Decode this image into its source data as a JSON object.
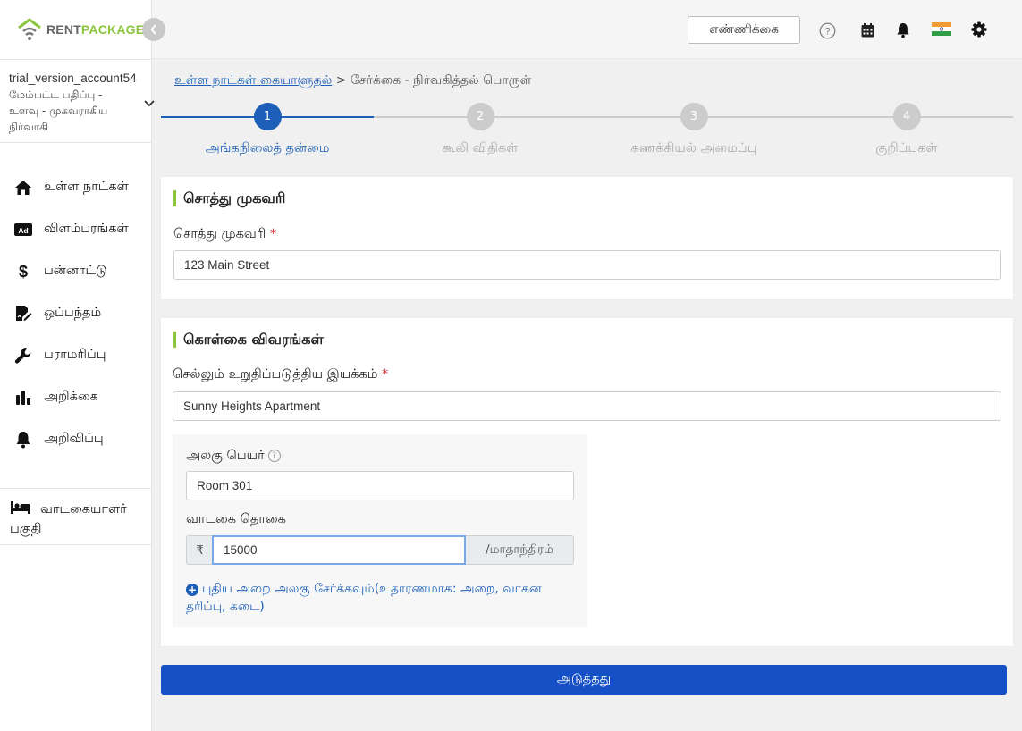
{
  "brand": {
    "rent": "RENT",
    "package": "PACKAGE"
  },
  "account": {
    "name": "trial_version_account54",
    "role": "மேம்பட்ட பதிப்பு - உளவு - முகவராகிய நிர்வாகி"
  },
  "sidebar": {
    "items": [
      {
        "label": "உள்ள நாட்கள்",
        "icon": "home-icon"
      },
      {
        "label": "விளம்பரங்கள்",
        "icon": "ad-icon"
      },
      {
        "label": "பன்னாட்டு",
        "icon": "dollar-icon"
      },
      {
        "label": "ஒப்பந்தம்",
        "icon": "contract-icon"
      },
      {
        "label": "பராமரிப்பு",
        "icon": "wrench-icon"
      },
      {
        "label": "அறிக்கை",
        "icon": "chart-icon"
      },
      {
        "label": "அறிவிப்பு",
        "icon": "bell-icon"
      }
    ],
    "tenant": {
      "label": "வாடகையாளர் பகுதி",
      "icon": "bed-icon"
    }
  },
  "topbar": {
    "count_label": "எண்ணிக்கை"
  },
  "breadcrumb": {
    "link": "உள்ள நாட்கள் கையாளுதல்",
    "separator": ">",
    "current": "சேர்க்கை - நிர்வகித்தல் பொருள்"
  },
  "stepper": {
    "active_color": "#1d5fb8",
    "inactive_color": "#cccccc",
    "steps": [
      {
        "number": "1",
        "label": "அங்கநிலைத் தன்மை",
        "active": true
      },
      {
        "number": "2",
        "label": "கூலி விதிகள்",
        "active": false
      },
      {
        "number": "3",
        "label": "கணக்கியல் அமைப்பு",
        "active": false
      },
      {
        "number": "4",
        "label": "குறிப்புகள்",
        "active": false
      }
    ]
  },
  "address_card": {
    "title": "சொத்து முகவரி",
    "field_label": "சொத்து முகவரி",
    "required_mark": "*",
    "value": "123 Main Street"
  },
  "policy_card": {
    "title": "கொள்கை விவரங்கள்",
    "property_label": "செல்லும் உறுதிப்படுத்திய இயக்கம்",
    "required_mark": "*",
    "property_value": "Sunny Heights Apartment",
    "unit_name_label": "அலகு பெயர்",
    "unit_help": "?",
    "unit_name_value": "Room 301",
    "rent_label": "வாடகை தொகை",
    "currency": "₹",
    "rent_value": "15000",
    "period": "/மாதாந்திரம்",
    "add_unit_link": "புதிய அறை அலகு சேர்க்கவும்(உதாரணமாக: அறை, வாகன தரிப்பு, கடை)"
  },
  "next_button": {
    "label": "அடுத்தது"
  }
}
